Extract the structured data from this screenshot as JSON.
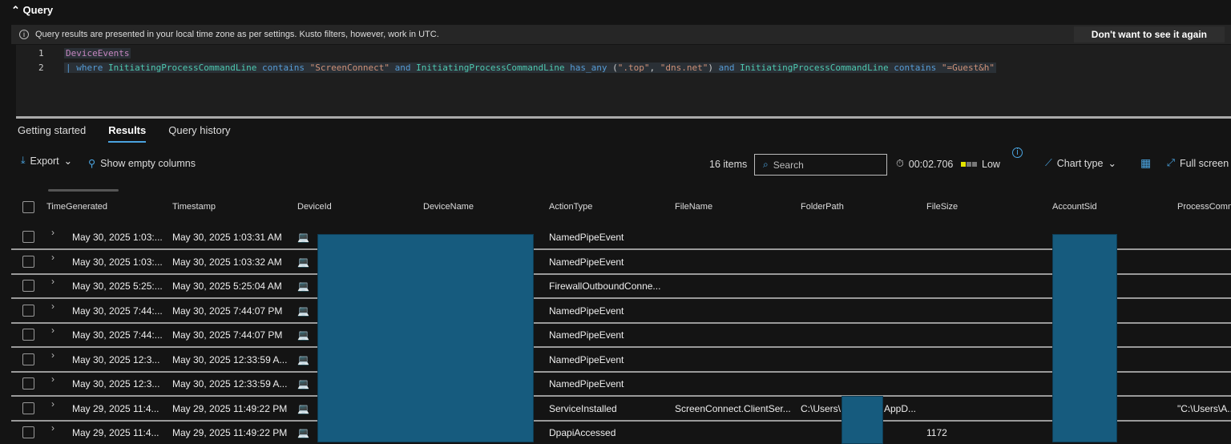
{
  "query": {
    "title": "Query",
    "info": "Query results are presented in your local time zone as per settings. Kusto filters, however, work in UTC.",
    "dismiss": "Don't want to see it again",
    "lines": [
      {
        "n": "1",
        "tokens": [
          {
            "c": "kw",
            "t": "DeviceEvents"
          }
        ]
      },
      {
        "n": "2",
        "tokens": [
          {
            "c": "op",
            "t": "| where "
          },
          {
            "c": "fn",
            "t": "InitiatingProcessCommandLine"
          },
          {
            "c": "op",
            "t": " contains "
          },
          {
            "c": "st",
            "t": "\"ScreenConnect\""
          },
          {
            "c": "op",
            "t": " and "
          },
          {
            "c": "fn",
            "t": "InitiatingProcessCommandLine"
          },
          {
            "c": "op",
            "t": " has_any "
          },
          {
            "c": "pl",
            "t": "("
          },
          {
            "c": "st",
            "t": "\".top\""
          },
          {
            "c": "pl",
            "t": ", "
          },
          {
            "c": "st",
            "t": "\"dns.net\""
          },
          {
            "c": "pl",
            "t": ")"
          },
          {
            "c": "op",
            "t": " and "
          },
          {
            "c": "fn",
            "t": "InitiatingProcessCommandLine"
          },
          {
            "c": "op",
            "t": " contains "
          },
          {
            "c": "st",
            "t": "\"=Guest&h\""
          }
        ]
      }
    ]
  },
  "tabs": [
    "Getting started",
    "Results",
    "Query history"
  ],
  "toolbar": {
    "export": "Export",
    "show_empty": "Show empty columns",
    "items": "16 items",
    "search_placeholder": "Search",
    "duration": "00:02.706",
    "usage": "Low",
    "chart_type": "Chart type",
    "full_screen": "Full screen"
  },
  "columns": [
    "TimeGenerated",
    "Timestamp",
    "DeviceId",
    "DeviceName",
    "ActionType",
    "FileName",
    "FolderPath",
    "FileSize",
    "AccountSid",
    "ProcessComm"
  ],
  "rows": [
    {
      "tg": "May 30, 2025 1:03:...",
      "ts": "May 30, 2025 1:03:31 AM",
      "action": "NamedPipeEvent"
    },
    {
      "tg": "May 30, 2025 1:03:...",
      "ts": "May 30, 2025 1:03:32 AM",
      "action": "NamedPipeEvent"
    },
    {
      "tg": "May 30, 2025 5:25:...",
      "ts": "May 30, 2025 5:25:04 AM",
      "action": "FirewallOutboundConne..."
    },
    {
      "tg": "May 30, 2025 7:44:...",
      "ts": "May 30, 2025 7:44:07 PM",
      "action": "NamedPipeEvent"
    },
    {
      "tg": "May 30, 2025 7:44:...",
      "ts": "May 30, 2025 7:44:07 PM",
      "action": "NamedPipeEvent"
    },
    {
      "tg": "May 30, 2025 12:3...",
      "ts": "May 30, 2025 12:33:59 A...",
      "action": "NamedPipeEvent"
    },
    {
      "tg": "May 30, 2025 12:3...",
      "ts": "May 30, 2025 12:33:59 A...",
      "action": "NamedPipeEvent"
    },
    {
      "tg": "May 29, 2025 11:4...",
      "ts": "May 29, 2025 11:49:22 PM",
      "action": "ServiceInstalled",
      "file": "ScreenConnect.ClientSer...",
      "folder": "C:\\Users\\",
      "folder2": "AppD...",
      "cmd": "\"C:\\Users\\A..."
    },
    {
      "tg": "May 29, 2025 11:4...",
      "ts": "May 29, 2025 11:49:22 PM",
      "action": "DpapiAccessed",
      "size": "1172"
    }
  ],
  "colors": {
    "accent": "#4aa3df",
    "redaction": "#165b7e"
  }
}
